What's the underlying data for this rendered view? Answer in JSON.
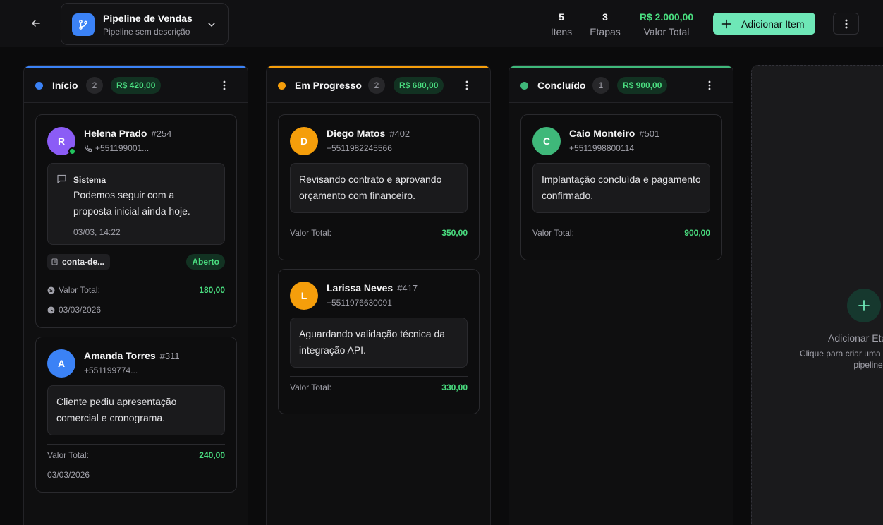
{
  "header": {
    "pipeline_name": "Pipeline de Vendas",
    "pipeline_description": "Pipeline sem descrição",
    "stats": [
      {
        "value": "5",
        "label": "Itens"
      },
      {
        "value": "3",
        "label": "Etapas"
      },
      {
        "value": "R$ 2.000,00",
        "label": "Valor Total"
      }
    ],
    "add_item_label": "Adicionar Item"
  },
  "colors": {
    "accent": "#6ee7b7",
    "inicio": "#3b82f6",
    "em_progresso": "#f59e0b",
    "concluido": "#3fb87a",
    "positive": "#4ade80"
  },
  "columns": [
    {
      "title": "Início",
      "count": "2",
      "total": "R$ 420,00",
      "cards": [
        {
          "initial": "R",
          "name": "Helena Prado",
          "id": "#254",
          "phone": "+551199001...",
          "note_author": "Sistema",
          "note_text": "Podemos seguir com a proposta inicial ainda hoje.",
          "note_time": "03/03, 14:22",
          "tag": "conta-de...",
          "status": "Aberto",
          "total_label": "Valor Total:",
          "total_value": "180,00",
          "date": "03/03/2026"
        },
        {
          "initial": "A",
          "name": "Amanda Torres",
          "id": "#311",
          "phone": "+551199774...",
          "note_text": "Cliente pediu apresentação comercial e cronograma.",
          "total_label": "Valor Total:",
          "total_value": "240,00",
          "date": "03/03/2026"
        }
      ]
    },
    {
      "title": "Em Progresso",
      "count": "2",
      "total": "R$ 680,00",
      "cards": [
        {
          "initial": "D",
          "name": "Diego Matos",
          "id": "#402",
          "phone": "+5511982245566",
          "note_text": "Revisando contrato e aprovando orçamento com financeiro.",
          "total_label": "Valor Total:",
          "total_value": "350,00"
        },
        {
          "initial": "L",
          "name": "Larissa Neves",
          "id": "#417",
          "phone": "+5511976630091",
          "note_text": "Aguardando validação técnica da integração API.",
          "total_label": "Valor Total:",
          "total_value": "330,00"
        }
      ]
    },
    {
      "title": "Concluído",
      "count": "1",
      "total": "R$ 900,00",
      "cards": [
        {
          "initial": "C",
          "name": "Caio Monteiro",
          "id": "#501",
          "phone": "+5511998800114",
          "note_text": "Implantação concluída e pagamento confirmado.",
          "total_label": "Valor Total:",
          "total_value": "900,00"
        }
      ]
    }
  ],
  "add_stage": {
    "title": "Adicionar Etapa",
    "description": "Clique para criar uma nova etapa no pipeline"
  },
  "icons": {
    "back": "arrow-left-icon",
    "pipeline": "git-branch-icon",
    "chevron": "chevron-down-icon",
    "plus": "plus-icon",
    "more": "more-vertical-icon",
    "phone": "phone-icon",
    "message": "message-square-icon",
    "account": "account-icon",
    "money": "dollar-circle-icon",
    "clock": "clock-icon"
  }
}
